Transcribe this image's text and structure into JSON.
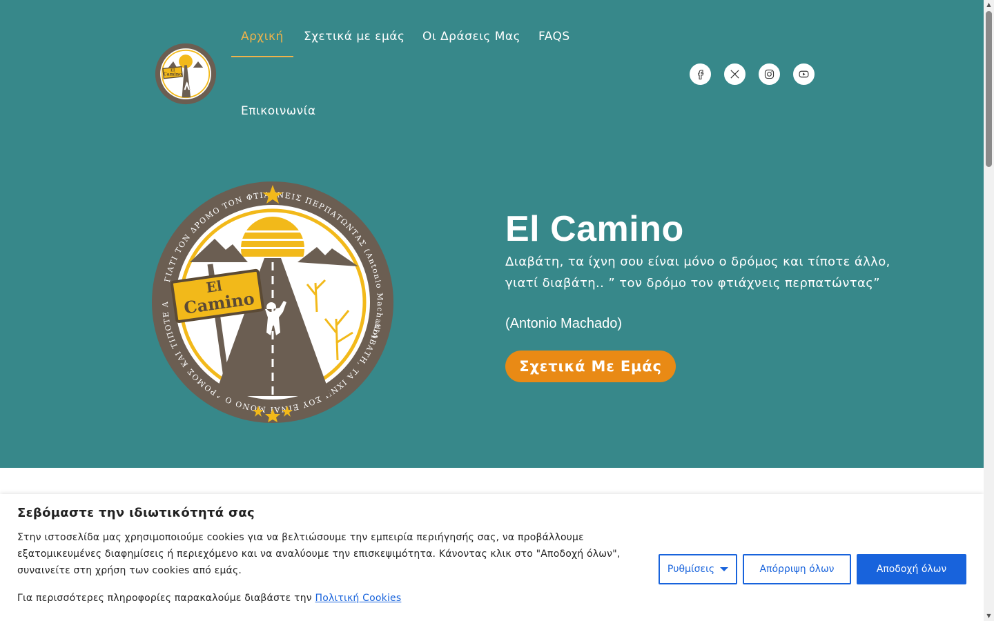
{
  "nav": {
    "items": [
      {
        "label": "Αρχική",
        "active": true
      },
      {
        "label": "Σχετικά με εμάς",
        "active": false
      },
      {
        "label": "Οι Δράσεις Μας",
        "active": false
      },
      {
        "label": "FAQS",
        "active": false
      },
      {
        "label": "Επικοινωνία",
        "active": false
      }
    ]
  },
  "social": [
    {
      "icon": "facebook-icon"
    },
    {
      "icon": "x-twitter-icon"
    },
    {
      "icon": "instagram-icon"
    },
    {
      "icon": "youtube-icon"
    }
  ],
  "logo": {
    "sign_line1": "El",
    "sign_line2": "Camino",
    "ring_text_top": "ΓΙΑΤΙ ΤΟΝ ΔΡΟΜΟ ΤΟΝ ΦΤΙΑΧΝΕΙΣ ΠΕΡΠΑΤΩΝΤΑΣ (Antonio Machado)",
    "ring_text_left": "ΔΙΑΒΑΤΗ, ΤΑ ΙΧΝΗ ΣΟΥ ΕΙΝΑΙ ΜΟΝΟ Ο ΔΡΟΜΟΣ ΚΑΙ ΤΙΠΟΤΕ ΑΛΛΟ"
  },
  "hero": {
    "title": "El Camino",
    "quote": "Διαβάτη, τα ίχνη σου είναι μόνο ο δρόμος και τίποτε άλλο, γιατί διαβάτη.. ” τον δρόμο τον φτιάχνεις περπατώντας”",
    "author": "(Antonio Machado)",
    "cta": "Σχετικά Με Εμάς"
  },
  "cookie": {
    "title": "Σεβόμαστε την ιδιωτικότητά σας",
    "text": "Στην ιστοσελίδα μας χρησιμοποιούμε cookies για να βελτιώσουμε την εμπειρία περιήγησής σας, να προβάλλουμε εξατομικευμένες διαφημίσεις ή περιεχόμενο και να αναλύουμε την επισκεψιμότητα. Κάνοντας κλικ στο \"Αποδοχή όλων\", συναινείτε στη χρήση των cookies από εμάς.",
    "more_prefix": "Για περισσότερες πληροφορίες παρακαλούμε διαβάστε την ",
    "more_link": "Πολιτική Cookies",
    "settings": "Ρυθμίσεις",
    "reject": "Απόρριψη όλων",
    "accept": "Αποδοχή όλων"
  },
  "colors": {
    "hero_bg": "#37888a",
    "accent": "#f0b34a",
    "cta": "#e98a15",
    "cookie_blue": "#1863dc"
  }
}
